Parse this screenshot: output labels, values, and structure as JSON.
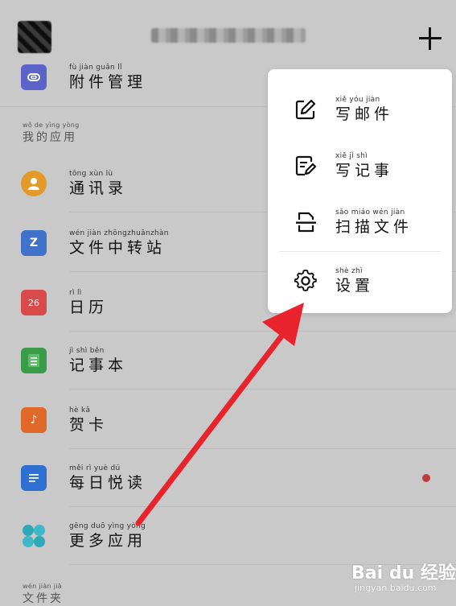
{
  "header": {
    "add_icon": "plus-icon"
  },
  "top_item": {
    "pinyin": "fù jiàn guǎn lǐ",
    "label": "附件管理",
    "icon": "attachment-icon",
    "color": "#5b63c9"
  },
  "section_apps": {
    "pinyin": "wǒ de yìng yòng",
    "label": "我的应用"
  },
  "apps": [
    {
      "pinyin": "tōng xùn lù",
      "label": "通讯录",
      "icon": "contacts-icon",
      "color": "#e39a2a",
      "glyph": ""
    },
    {
      "pinyin": "wén jiàn zhōngzhuǎnzhàn",
      "label": "文件中转站",
      "icon": "file-transfer-icon",
      "color": "#3f72c8",
      "glyph": "Z"
    },
    {
      "pinyin": "rì lì",
      "label": "日历",
      "icon": "calendar-icon",
      "color": "#d94b4b",
      "glyph": "26"
    },
    {
      "pinyin": "jì shì běn",
      "label": "记事本",
      "icon": "notepad-icon",
      "color": "#3a9c48",
      "glyph": ""
    },
    {
      "pinyin": "hè kǎ",
      "label": "贺卡",
      "icon": "greeting-card-icon",
      "color": "#e0692a",
      "glyph": "♪"
    },
    {
      "pinyin": "měi rì yuè dú",
      "label": "每日悦读",
      "icon": "daily-reading-icon",
      "color": "#2e6fd1",
      "glyph": ""
    },
    {
      "pinyin": "gēng duō yìng yòng",
      "label": "更多应用",
      "icon": "more-apps-icon",
      "color": "#2fa9b8",
      "glyph": ""
    }
  ],
  "section_files": {
    "pinyin": "wén jiàn jiā",
    "label": "文件夹"
  },
  "menu": {
    "items": [
      {
        "pinyin": "xiě yóu jiàn",
        "label": "写邮件",
        "icon": "compose-icon"
      },
      {
        "pinyin": "xiě jì shì",
        "label": "写记事",
        "icon": "write-note-icon"
      },
      {
        "pinyin": "sǎo miáo wén jiàn",
        "label": "扫描文件",
        "icon": "scan-icon"
      },
      {
        "pinyin": "shè zhì",
        "label": "设置",
        "icon": "settings-gear-icon"
      }
    ]
  },
  "watermark": {
    "main": "Bai du 经验",
    "sub": "jingyan.baidu.com"
  },
  "colors": {
    "arrow": "#e8232b",
    "overlay": "#c9c9c9",
    "menu_bg": "#ffffff"
  }
}
